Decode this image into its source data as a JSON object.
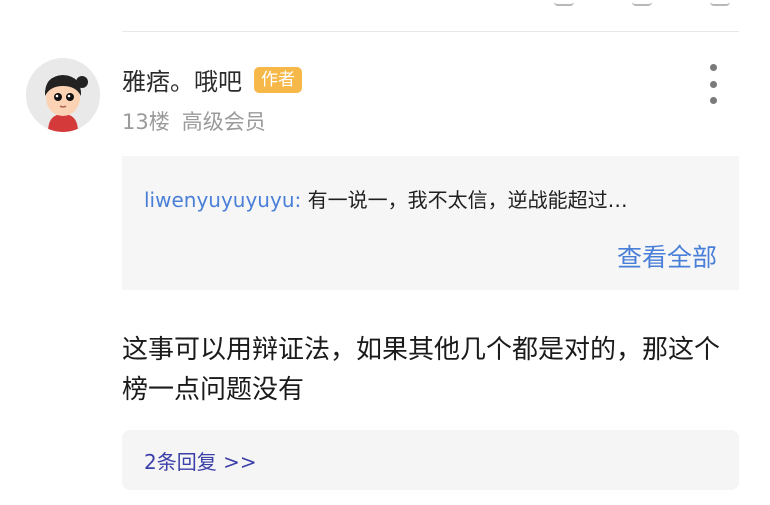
{
  "comment": {
    "username": "雅痞。哦吧",
    "badge": "作者",
    "floor": "13楼",
    "member_level": "高级会员",
    "quote": {
      "user": "liwenyuyuyuyu:",
      "text": "有一说一，我不太信，逆战能超过…",
      "view_all": "查看全部"
    },
    "body": "这事可以用辩证法，如果其他几个都是对的，那这个榜一点问题没有",
    "replies_link": "2条回复 >>"
  },
  "colors": {
    "badge": "#f7b84a",
    "link_blue": "#4a7fd8",
    "replies_link": "#3b3fa8",
    "quote_bg": "#f6f6f7"
  }
}
